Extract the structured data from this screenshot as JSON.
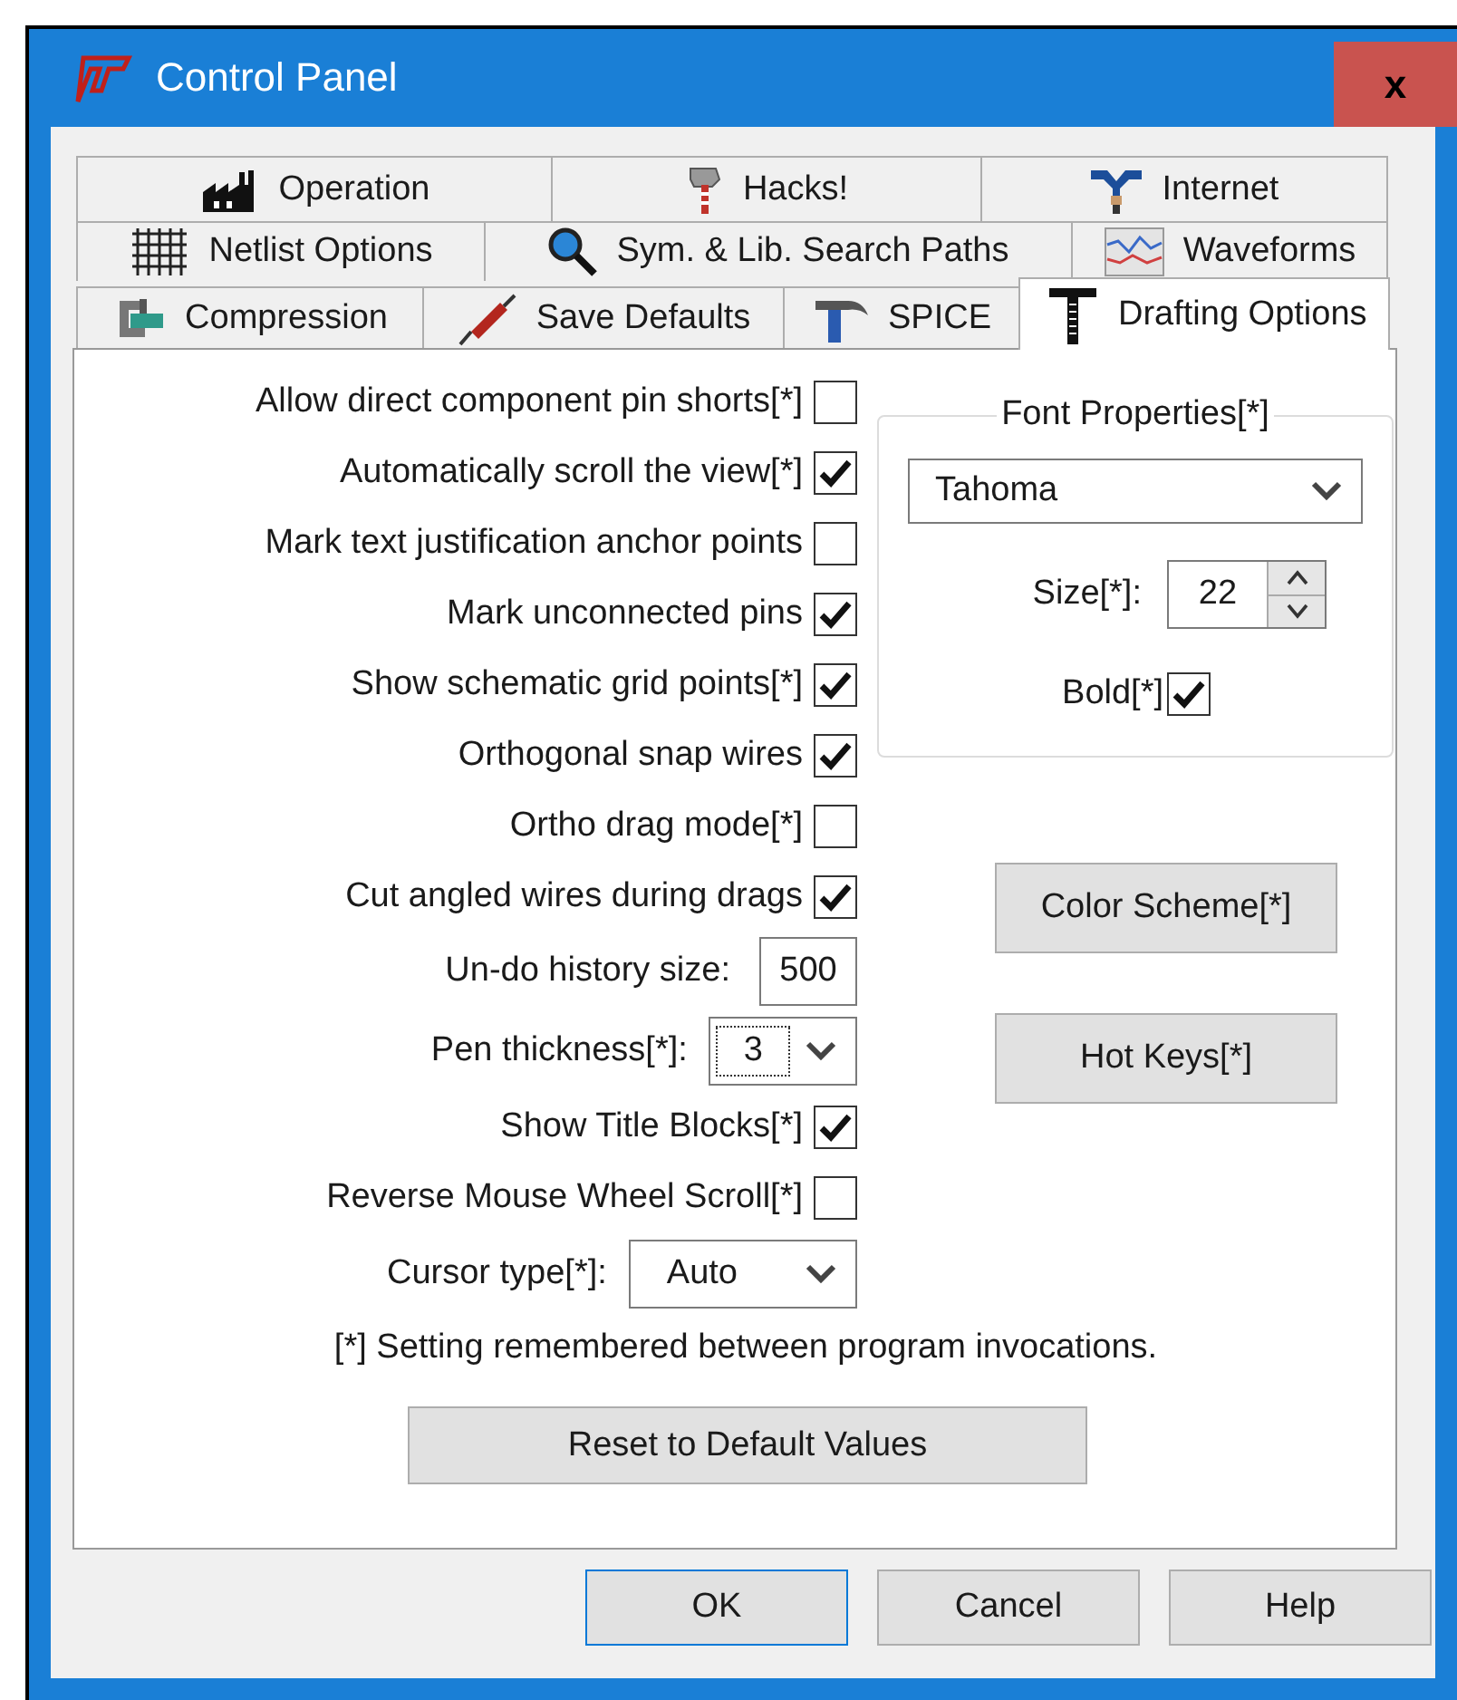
{
  "window": {
    "title": "Control Panel",
    "close": "x"
  },
  "tab_rows": [
    [
      {
        "label": "Operation",
        "selected": false
      },
      {
        "label": "Hacks!",
        "selected": false
      },
      {
        "label": "Internet",
        "selected": false
      }
    ],
    [
      {
        "label": "Netlist Options",
        "selected": false
      },
      {
        "label": "Sym. & Lib. Search Paths",
        "selected": false
      },
      {
        "label": "Waveforms",
        "selected": false
      }
    ],
    [
      {
        "label": "Compression",
        "selected": false
      },
      {
        "label": "Save Defaults",
        "selected": false
      },
      {
        "label": "SPICE",
        "selected": false
      },
      {
        "label": "Drafting Options",
        "selected": true
      }
    ]
  ],
  "options": [
    {
      "kind": "checkbox",
      "label": "Allow direct component pin shorts[*]",
      "checked": false
    },
    {
      "kind": "checkbox",
      "label": "Automatically scroll the view[*]",
      "checked": true
    },
    {
      "kind": "checkbox",
      "label": "Mark text justification anchor points",
      "checked": false
    },
    {
      "kind": "checkbox",
      "label": "Mark unconnected pins",
      "checked": true
    },
    {
      "kind": "checkbox",
      "label": "Show schematic grid points[*]",
      "checked": true
    },
    {
      "kind": "checkbox",
      "label": "Orthogonal snap wires",
      "checked": true
    },
    {
      "kind": "checkbox",
      "label": "Ortho drag mode[*]",
      "checked": false
    },
    {
      "kind": "checkbox",
      "label": "Cut angled wires during drags",
      "checked": true
    },
    {
      "kind": "number",
      "label": "Un-do history size:",
      "value": "500"
    },
    {
      "kind": "dropdown",
      "label": "Pen thickness[*]:",
      "value": "3",
      "focused": true
    },
    {
      "kind": "checkbox",
      "label": "Show Title Blocks[*]",
      "checked": true
    },
    {
      "kind": "checkbox",
      "label": "Reverse Mouse Wheel Scroll[*]",
      "checked": false
    },
    {
      "kind": "dropdown",
      "label": "Cursor type[*]:",
      "value": "Auto",
      "focused": false
    }
  ],
  "note": "[*] Setting remembered between program invocations.",
  "reset_button": "Reset to Default Values",
  "font_properties": {
    "title": "Font Properties[*]",
    "font": "Tahoma",
    "size_label": "Size[*]:",
    "size": "22",
    "bold_label": "Bold[*]",
    "bold": true
  },
  "side_buttons": [
    "Color Scheme[*]",
    "Hot Keys[*]"
  ],
  "buttons": [
    {
      "label": "OK",
      "default": true
    },
    {
      "label": "Cancel",
      "default": false
    },
    {
      "label": "Help",
      "default": false
    }
  ]
}
